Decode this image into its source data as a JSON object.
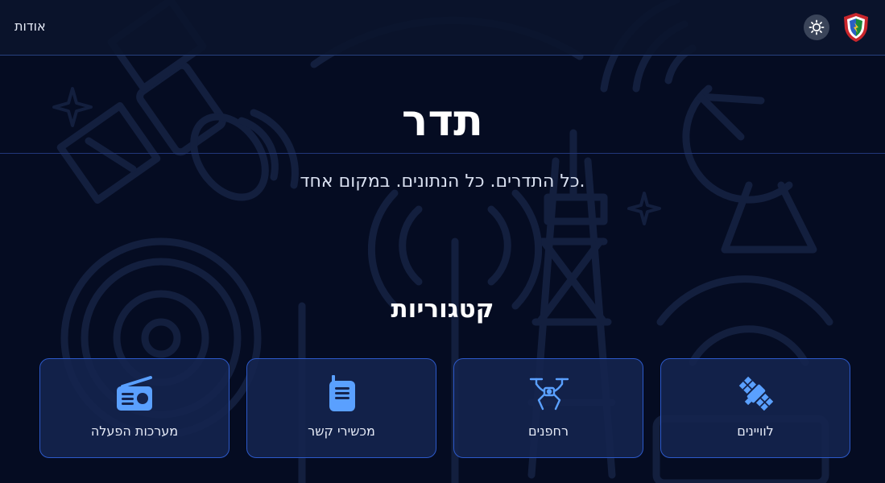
{
  "header": {
    "about_label": "אודות",
    "theme_toggle_icon": "sun-icon",
    "logo_icon": "shield-logo"
  },
  "hero": {
    "title": "תדר",
    "subtitle": "כל התדרים. כל הנתונים. במקום אחד."
  },
  "categories": {
    "title": "קטגוריות",
    "items": [
      {
        "label": "מערכות הפעלה",
        "icon": "radio-icon"
      },
      {
        "label": "מכשירי קשר",
        "icon": "walkie-talkie-icon"
      },
      {
        "label": "רחפנים",
        "icon": "drone-icon"
      },
      {
        "label": "לוויינים",
        "icon": "satellite-icon"
      }
    ]
  },
  "colors": {
    "background": "#050c22",
    "header": "#0b152c",
    "card_border": "#2c59c9",
    "accent_icon": "#5aa0ff"
  }
}
